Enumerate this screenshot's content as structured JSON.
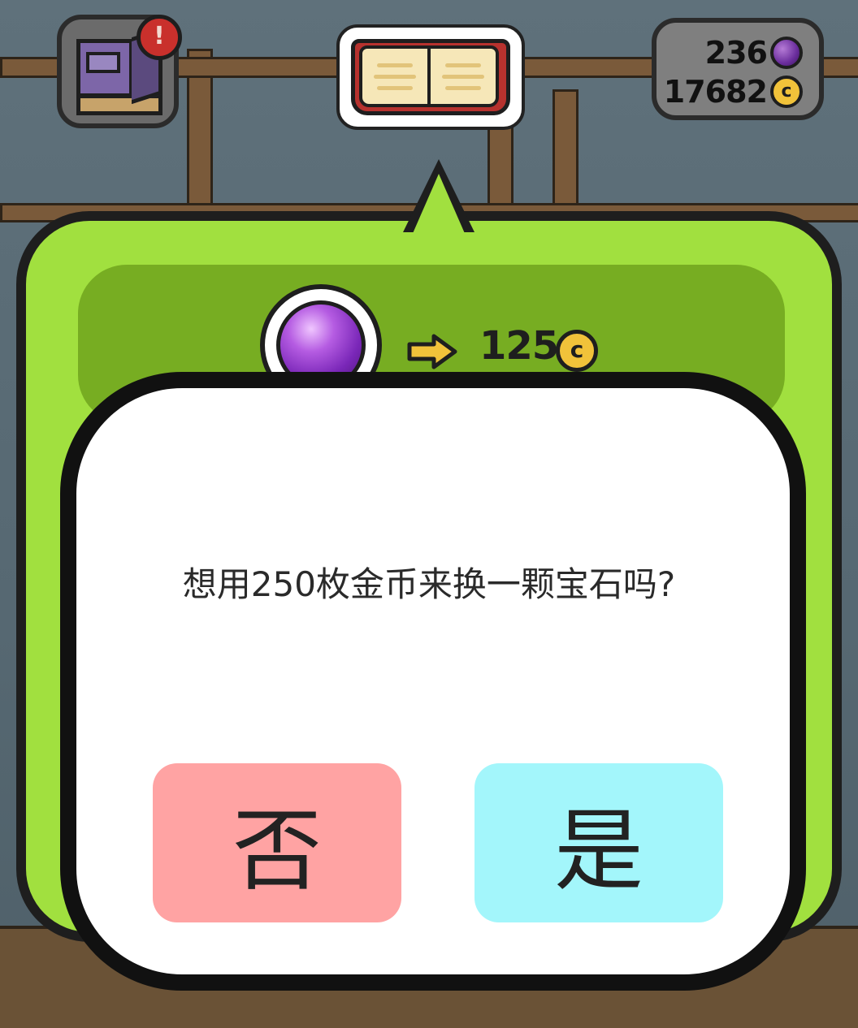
{
  "hud": {
    "alert_badge": "!",
    "gems": "236",
    "coins": "17682",
    "coin_symbol": "c"
  },
  "exchange": {
    "rate": "125",
    "coin_symbol": "c"
  },
  "dialog": {
    "message": "想用250枚金币来换一颗宝石吗?",
    "no_label": "否",
    "yes_label": "是"
  },
  "colors": {
    "bubble_green": "#a1e03f",
    "strip_green": "#77ad22",
    "no_button": "#ffa3a3",
    "yes_button": "#a3f6fb"
  },
  "icons": [
    "house-icon",
    "book-icon",
    "gem-icon",
    "coin-icon",
    "arrow-right-icon"
  ]
}
